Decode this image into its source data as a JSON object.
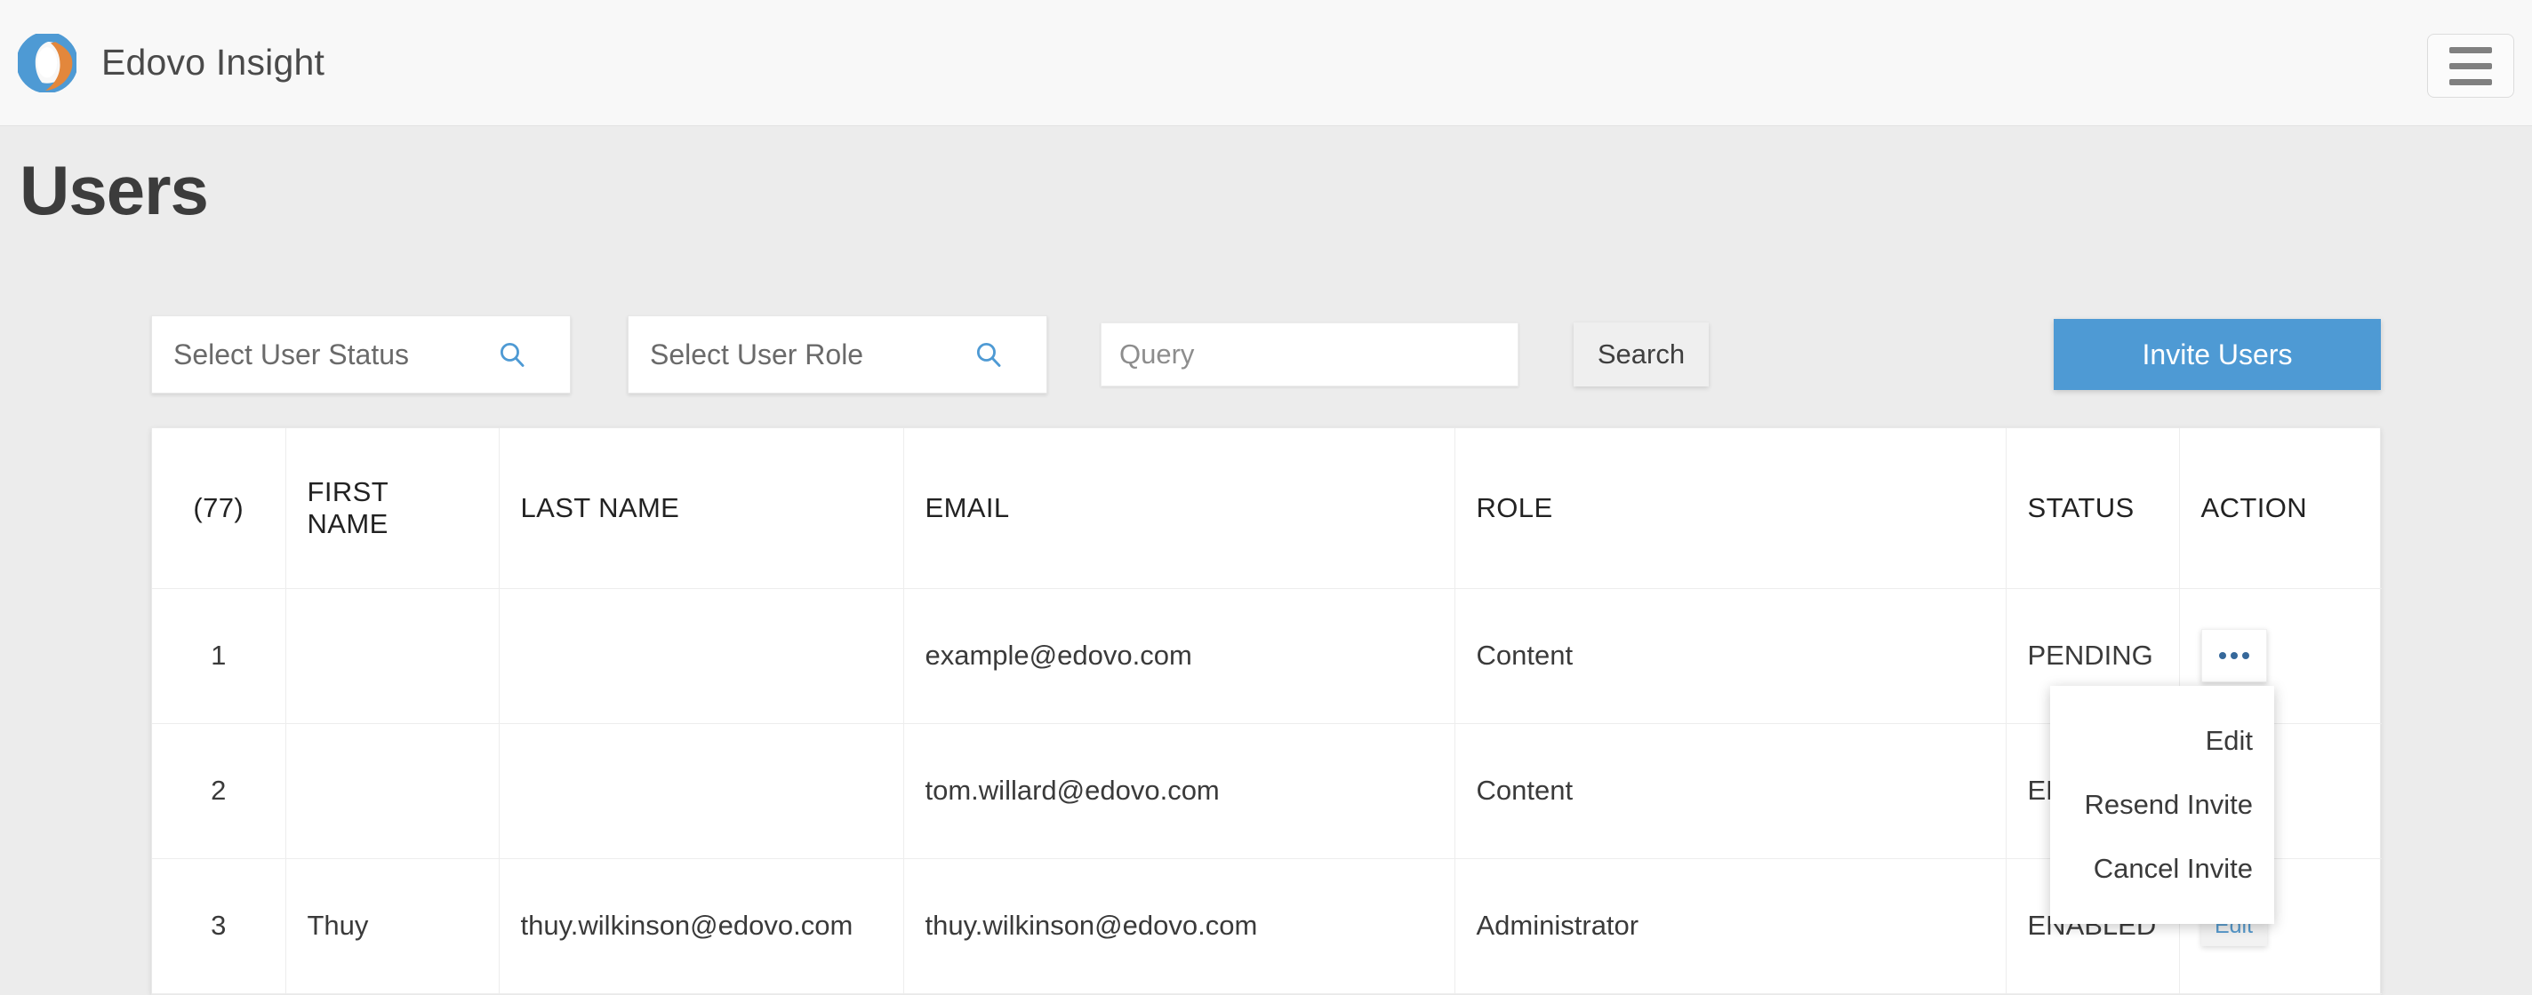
{
  "navbar": {
    "brand_title": "Edovo Insight",
    "logo_icon": "edovo-logo-icon",
    "logo_colors": {
      "blue": "#4e9ad4",
      "orange": "#e3873c"
    },
    "menu_icon": "hamburger-menu-icon"
  },
  "page": {
    "title": "Users"
  },
  "filters": {
    "user_status": {
      "placeholder": "Select User Status",
      "value": "",
      "icon": "search-icon"
    },
    "user_role": {
      "placeholder": "Select User Role",
      "value": "",
      "icon": "search-icon"
    },
    "query": {
      "placeholder": "Query",
      "value": ""
    },
    "search_button": "Search",
    "invite_button": "Invite Users"
  },
  "colors": {
    "accent_blue": "#4e9ad4",
    "link_blue": "#5599cc",
    "page_bg": "#ececec",
    "navbar_bg": "#f8f8f8"
  },
  "table": {
    "headers": {
      "count": "(77)",
      "first_name": "FIRST NAME",
      "last_name": "LAST NAME",
      "email": "EMAIL",
      "role": "ROLE",
      "status": "STATUS",
      "action": "ACTION"
    },
    "rows": [
      {
        "index": "1",
        "first_name": "",
        "last_name": "",
        "email": "example@edovo.com",
        "role": "Content",
        "status": "PENDING",
        "action": "..."
      },
      {
        "index": "2",
        "first_name": "",
        "last_name": "",
        "email": "tom.willard@edovo.com",
        "role": "Content",
        "status": "ENABLED",
        "action": "..."
      },
      {
        "index": "3",
        "first_name": "Thuy",
        "last_name": "thuy.wilkinson@edovo.com",
        "email": "thuy.wilkinson@edovo.com",
        "role": "Administrator",
        "status": "ENABLED",
        "action": "Edit"
      }
    ]
  },
  "action_menu": {
    "items": [
      {
        "label": "Edit"
      },
      {
        "label": "Resend Invite"
      },
      {
        "label": "Cancel Invite"
      }
    ]
  }
}
